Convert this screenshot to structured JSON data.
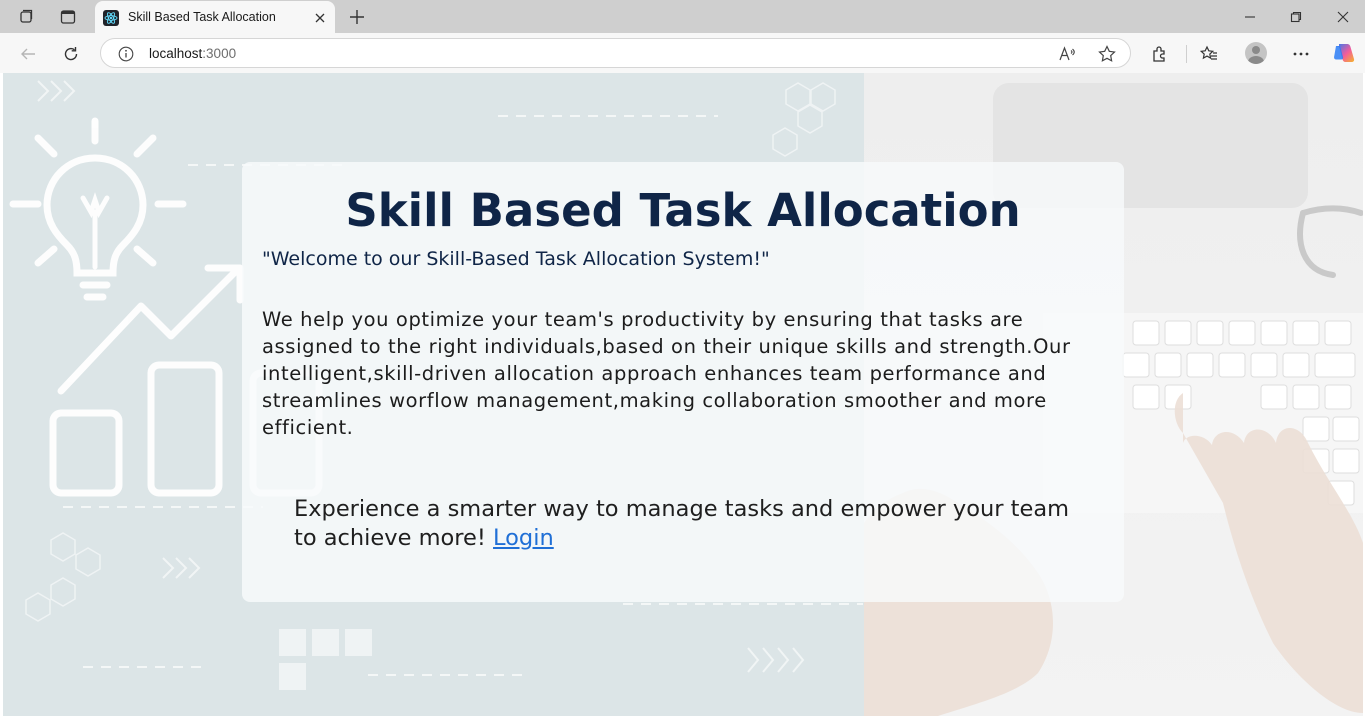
{
  "browser": {
    "tab": {
      "title": "Skill Based Task Allocation",
      "favicon": "react-icon"
    },
    "address": {
      "host": "localhost",
      "port": ":3000"
    },
    "accent_copilot": [
      "#2b7cf6",
      "#f35c9b",
      "#f6b52b"
    ]
  },
  "page": {
    "title": "Skill Based Task Allocation",
    "welcome": "\"Welcome to our Skill-Based Task Allocation System!\"",
    "description": "We help you optimize your team's productivity by ensuring that tasks are assigned to the right individuals,based on their unique skills and strength.Our intelligent,skill-driven allocation approach enhances team performance and streamlines worflow management,making collaboration smoother and more efficient.",
    "cta_text": "Experience a smarter way to manage tasks and empower your team to achieve more! ",
    "login_label": "Login",
    "colors": {
      "title": "#0f2547",
      "link": "#1f6fd6"
    }
  }
}
